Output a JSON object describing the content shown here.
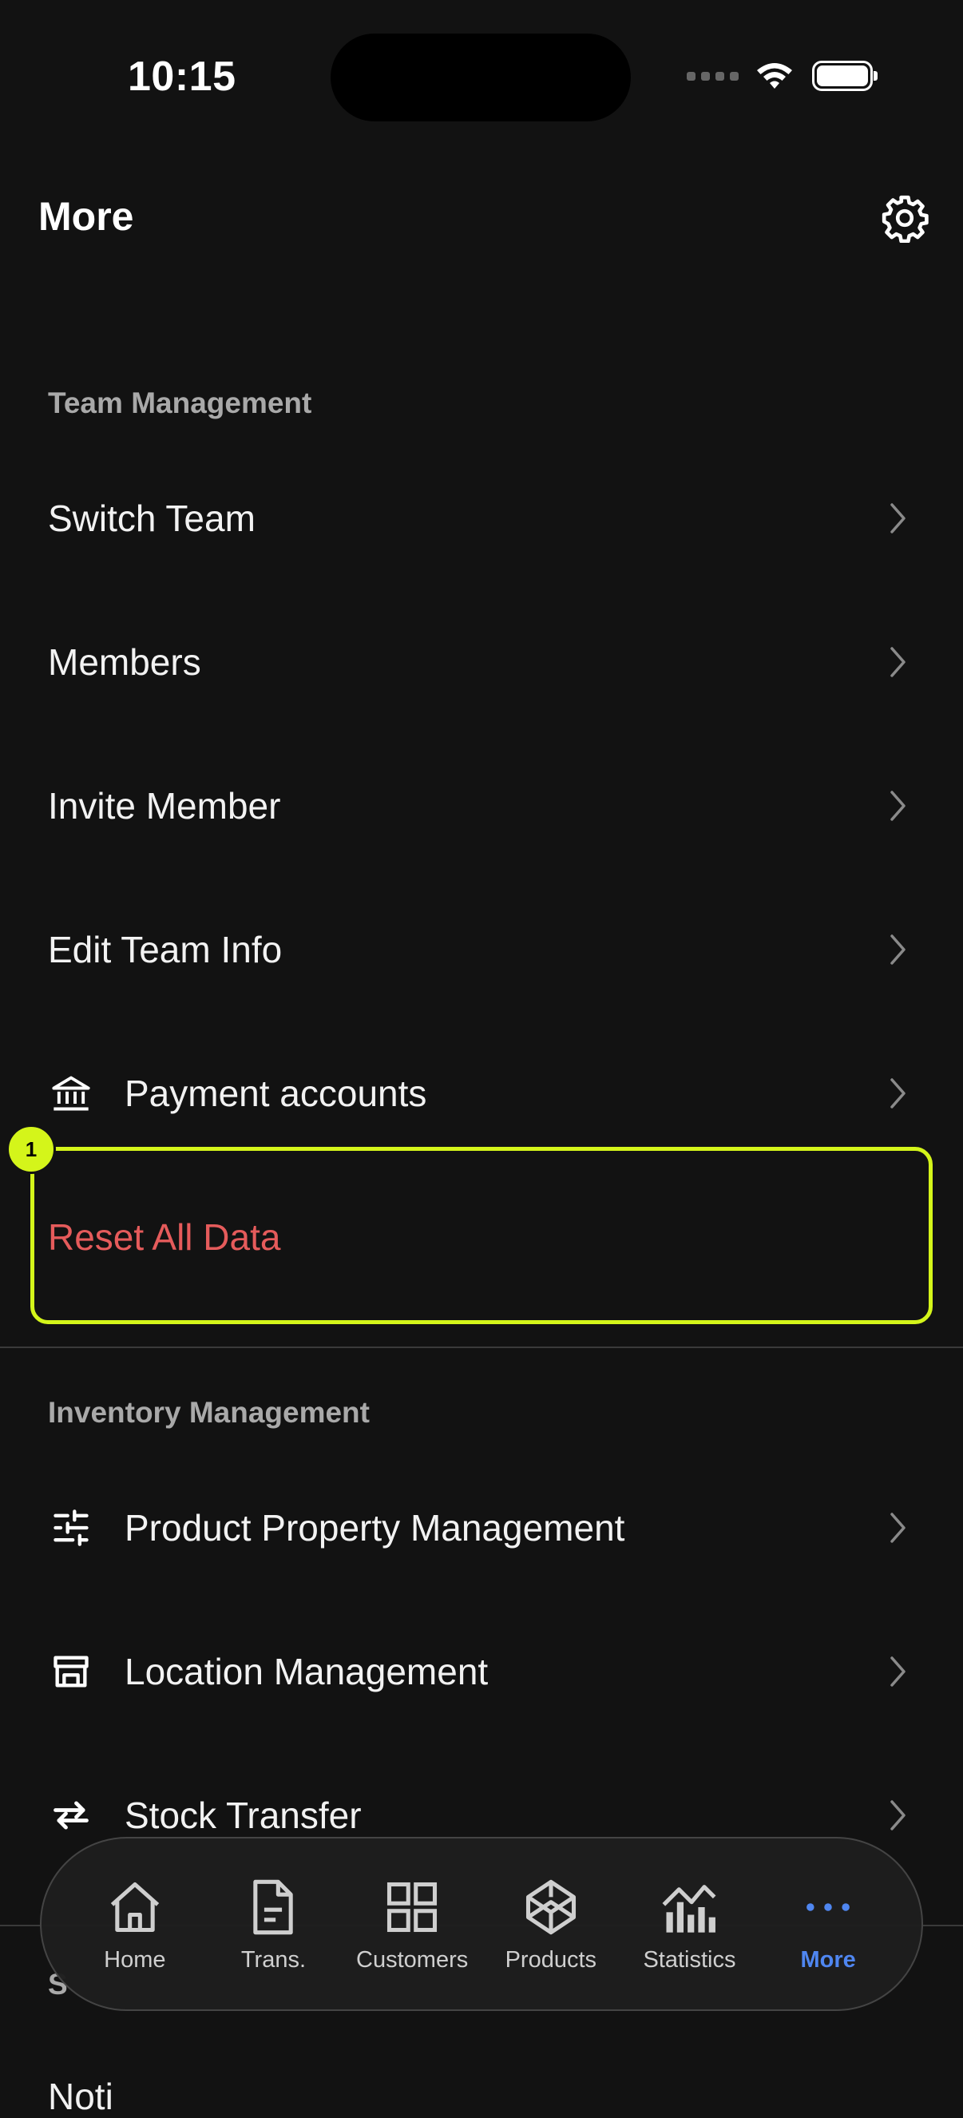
{
  "status_bar": {
    "time": "10:15"
  },
  "header": {
    "title": "More",
    "settings_icon": "gear-icon"
  },
  "team_management": {
    "section_title": "Team Management",
    "items": [
      {
        "label": "Switch Team"
      },
      {
        "label": "Members"
      },
      {
        "label": "Invite Member"
      },
      {
        "label": "Edit Team Info"
      },
      {
        "label": "Payment accounts",
        "icon": "bank-icon"
      },
      {
        "label": "Reset All Data",
        "color": "#e55b5b"
      }
    ]
  },
  "highlight": {
    "badge": "1",
    "color": "#d4f51a"
  },
  "inventory_management": {
    "section_title": "Inventory Management",
    "items": [
      {
        "label": "Product Property Management",
        "icon": "sliders-icon"
      },
      {
        "label": "Location Management",
        "icon": "store-icon"
      },
      {
        "label": "Stock Transfer",
        "icon": "transfer-arrows-icon"
      }
    ]
  },
  "partially_visible": {
    "section_title": "S",
    "item": "Noti"
  },
  "tab_bar": {
    "active_color": "#4f86f0",
    "tabs": [
      {
        "label": "Home",
        "icon": "home-icon"
      },
      {
        "label": "Trans.",
        "icon": "document-icon"
      },
      {
        "label": "Customers",
        "icon": "grid-icon"
      },
      {
        "label": "Products",
        "icon": "cube-icon"
      },
      {
        "label": "Statistics",
        "icon": "bar-chart-icon"
      },
      {
        "label": "More",
        "icon": "more-dots-icon",
        "active": true
      }
    ]
  }
}
